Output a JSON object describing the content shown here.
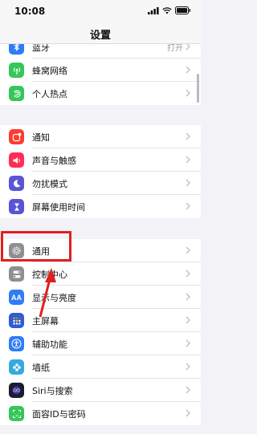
{
  "status": {
    "time": "10:08"
  },
  "nav": {
    "title": "设置"
  },
  "groups": [
    {
      "items": [
        {
          "label": "蓝牙",
          "value": "打开",
          "icon": "bluetooth-icon",
          "color": "#2f7cf6"
        },
        {
          "label": "蜂窝网络",
          "icon": "cellular-antenna-icon",
          "color": "#34c759"
        },
        {
          "label": "个人热点",
          "icon": "hotspot-icon",
          "color": "#34c759"
        }
      ]
    },
    {
      "items": [
        {
          "label": "通知",
          "icon": "notifications-icon",
          "color": "#ff3b30"
        },
        {
          "label": "声音与触感",
          "icon": "speaker-icon",
          "color": "#ff2d55"
        },
        {
          "label": "勿扰模式",
          "icon": "moon-icon",
          "color": "#5856d6"
        },
        {
          "label": "屏幕使用时间",
          "icon": "hourglass-icon",
          "color": "#5856d6"
        }
      ]
    },
    {
      "items": [
        {
          "label": "通用",
          "icon": "gear-icon",
          "color": "#8e8e93"
        },
        {
          "label": "控制中心",
          "icon": "toggles-icon",
          "color": "#8e8e93"
        },
        {
          "label": "显示与亮度",
          "icon": "text-size-icon",
          "color": "#2f7cf6"
        },
        {
          "label": "主屏幕",
          "icon": "home-grid-icon",
          "color": "#2f5bd6"
        },
        {
          "label": "辅助功能",
          "icon": "accessibility-icon",
          "color": "#2f7cf6"
        },
        {
          "label": "墙纸",
          "icon": "flower-icon",
          "color": "#35aadc"
        },
        {
          "label": "Siri与搜索",
          "icon": "siri-icon",
          "color": "#1c1c2e"
        },
        {
          "label": "面容ID与密码",
          "icon": "face-id-icon",
          "color": "#34c759"
        }
      ]
    }
  ],
  "annotation": {
    "color": "#e02020"
  }
}
